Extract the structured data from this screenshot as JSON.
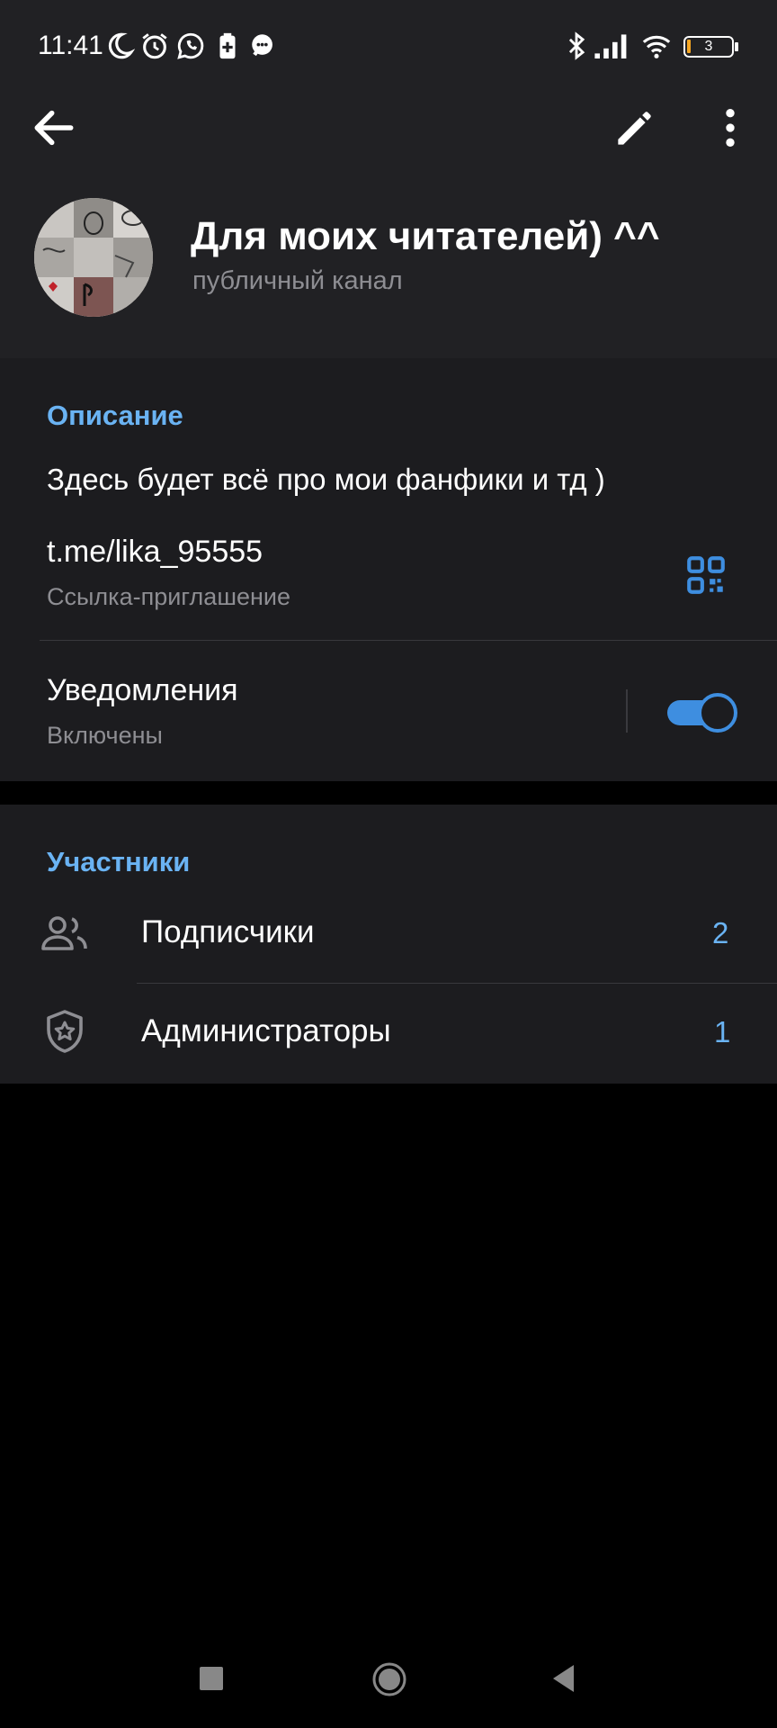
{
  "status_bar": {
    "time": "11:41",
    "battery_level": "3",
    "left_icons": [
      "moon-icon",
      "alarm-icon",
      "whatsapp-icon",
      "battery-saver-icon",
      "chat-icon"
    ],
    "right_icons": [
      "bluetooth-icon",
      "signal-icon",
      "wifi-icon",
      "battery-icon"
    ]
  },
  "toolbar": {
    "back_icon": "arrow-left-icon",
    "edit_icon": "pencil-icon",
    "more_icon": "more-vertical-icon"
  },
  "channel": {
    "title": "Для моих читателей) ^^",
    "subtitle": "публичный канал"
  },
  "info": {
    "description_heading": "Описание",
    "description_text": "Здесь будет всё про мои фанфики и тд )",
    "link": "t.me/lika_95555",
    "link_caption": "Ссылка-приглашение",
    "notifications_label": "Уведомления",
    "notifications_status": "Включены",
    "notifications_enabled": true
  },
  "members": {
    "heading": "Участники",
    "rows": [
      {
        "label": "Подписчики",
        "count": "2",
        "icon": "people-icon"
      },
      {
        "label": "Администраторы",
        "count": "1",
        "icon": "shield-star-icon"
      }
    ]
  },
  "colors": {
    "accent": "#6ab3f3",
    "toggle": "#3e8ee0",
    "header_bg": "#212124",
    "section_bg": "#1c1c1f",
    "page_bg": "#000000"
  }
}
